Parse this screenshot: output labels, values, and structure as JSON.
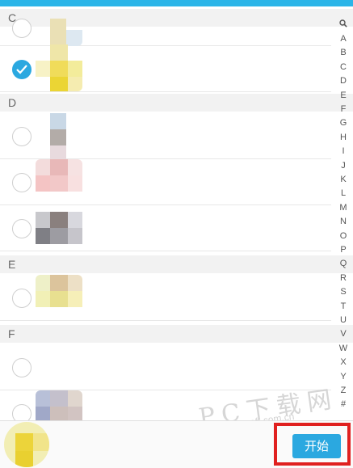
{
  "accent_color": "#2ba8e0",
  "sections": [
    {
      "letter": "C"
    },
    {
      "letter": "D"
    },
    {
      "letter": "E"
    },
    {
      "letter": "F"
    }
  ],
  "index_letters": [
    "A",
    "B",
    "C",
    "D",
    "E",
    "F",
    "G",
    "H",
    "I",
    "J",
    "K",
    "L",
    "M",
    "N",
    "O",
    "P",
    "Q",
    "R",
    "S",
    "T",
    "U",
    "V",
    "W",
    "X",
    "Y",
    "Z",
    "#"
  ],
  "index_search_icon": "search-icon",
  "start_button_label": "开始",
  "watermark": {
    "main": "PC下载网",
    "sub": "www.pcsoft.com.cn"
  }
}
